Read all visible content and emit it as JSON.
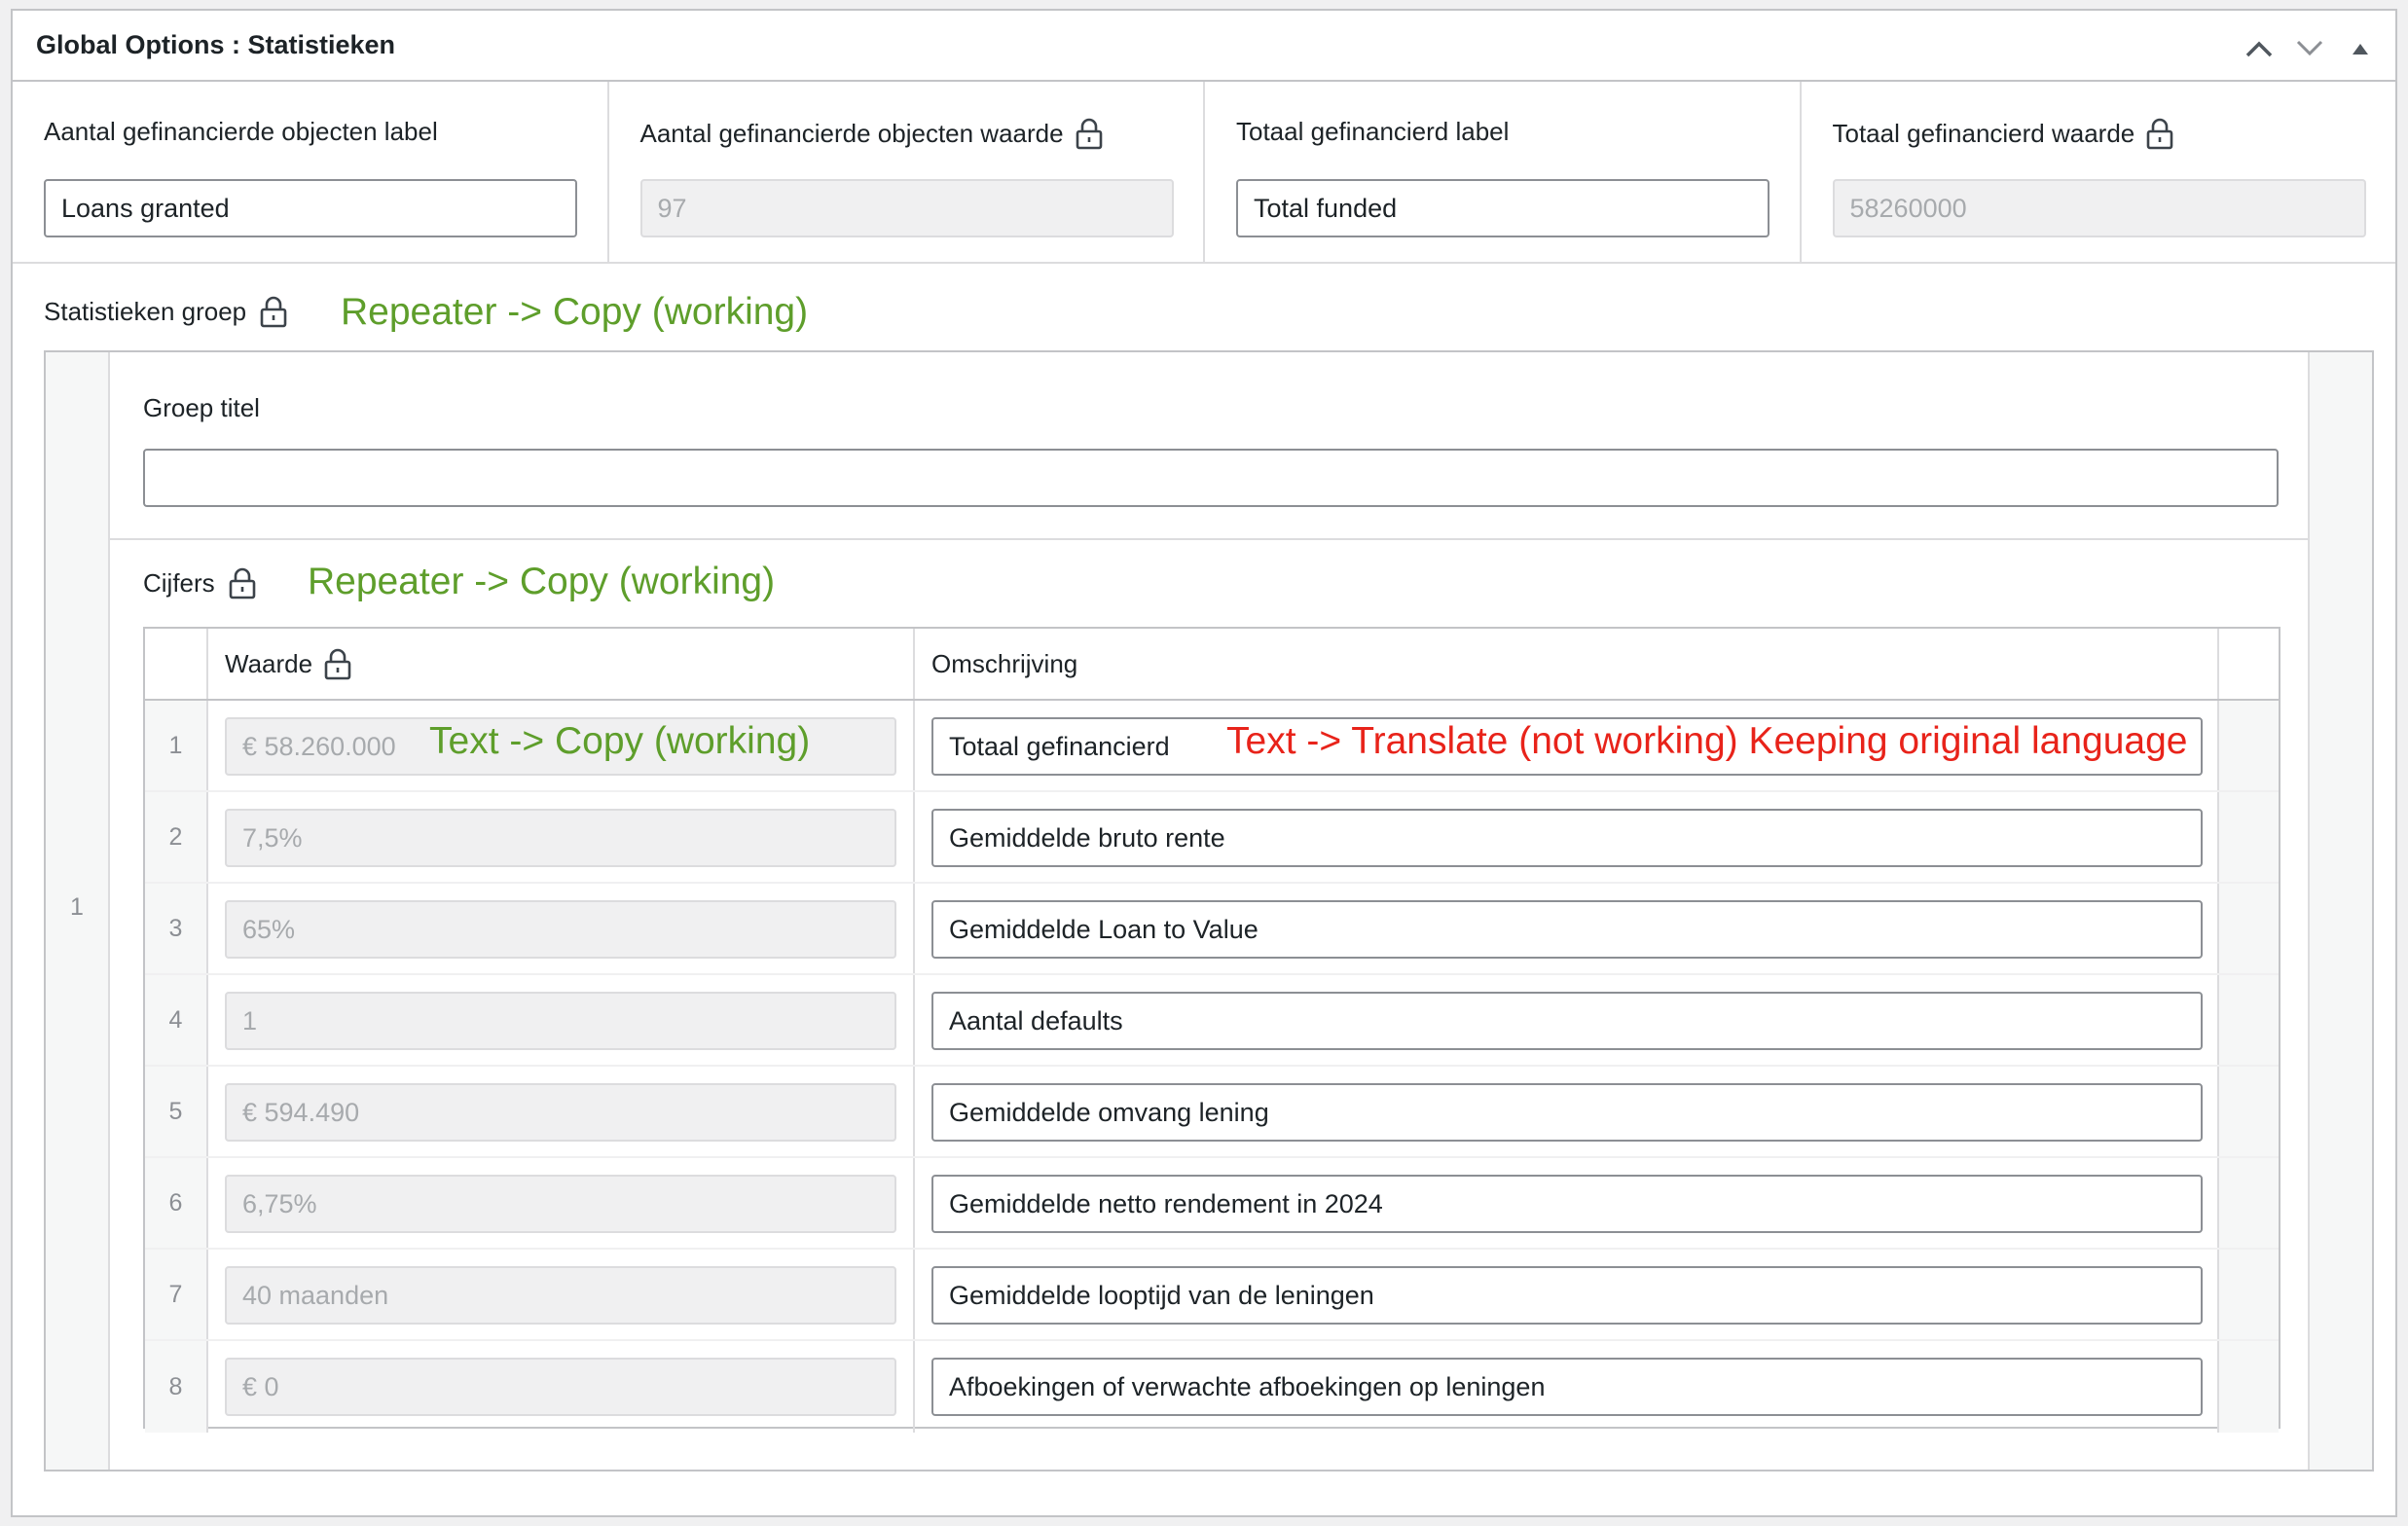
{
  "panel": {
    "title": "Global Options : Statistieken"
  },
  "top_fields": [
    {
      "label": "Aantal gefinancierde objecten label",
      "value": "Loans granted",
      "locked": false
    },
    {
      "label": "Aantal gefinancierde objecten waarde",
      "value": "97",
      "locked": true
    },
    {
      "label": "Totaal gefinancierd label",
      "value": "Total funded",
      "locked": false
    },
    {
      "label": "Totaal gefinancierd waarde",
      "value": "58260000",
      "locked": true
    }
  ],
  "statistieken_groep": {
    "label": "Statistieken groep",
    "note": "Repeater -> Copy (working)",
    "row_number": "1",
    "groep_titel_label": "Groep titel",
    "groep_titel_value": "",
    "cijfers": {
      "label": "Cijfers",
      "note": "Repeater -> Copy (working)",
      "columns": {
        "waarde": "Waarde",
        "omschrijving": "Omschrijving"
      },
      "rows": [
        {
          "num": "1",
          "waarde": "€ 58.260.000",
          "omschrijving": "Totaal gefinancierd"
        },
        {
          "num": "2",
          "waarde": "7,5%",
          "omschrijving": "Gemiddelde bruto rente"
        },
        {
          "num": "3",
          "waarde": "65%",
          "omschrijving": "Gemiddelde Loan to Value"
        },
        {
          "num": "4",
          "waarde": "1",
          "omschrijving": "Aantal defaults"
        },
        {
          "num": "5",
          "waarde": "€ 594.490",
          "omschrijving": "Gemiddelde omvang lening"
        },
        {
          "num": "6",
          "waarde": "6,75%",
          "omschrijving": "Gemiddelde netto rendement in 2024"
        },
        {
          "num": "7",
          "waarde": "40 maanden",
          "omschrijving": "Gemiddelde looptijd van de leningen"
        },
        {
          "num": "8",
          "waarde": "€ 0",
          "omschrijving": "Afboekingen of verwachte afboekingen op leningen"
        }
      ],
      "waarde_note": "Text -> Copy (working)",
      "omschrijving_note": "Text -> Translate (not working) Keeping original language"
    }
  },
  "colors": {
    "note_green": "#5e9e2b",
    "note_red": "#e8231a"
  },
  "icons": [
    "chevron-up-icon",
    "chevron-down-icon",
    "triangle-up-icon",
    "lock-icon"
  ]
}
